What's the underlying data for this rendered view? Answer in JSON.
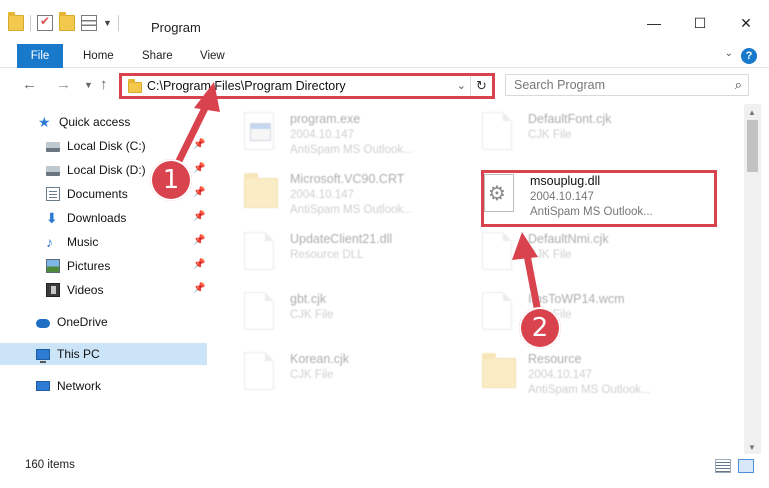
{
  "window": {
    "title": "Program",
    "minimize": "—",
    "maximize": "☐",
    "close": "✕"
  },
  "ribbon": {
    "tabs": [
      "File",
      "Home",
      "Share",
      "View"
    ],
    "help": "?"
  },
  "address": {
    "path": "C:\\Program Files\\Program Directory",
    "search_placeholder": "Search Program"
  },
  "sidebar": {
    "items": [
      {
        "label": "Quick access",
        "icon": "star-icon"
      },
      {
        "label": "Local Disk (C:)",
        "icon": "drive-icon",
        "pinned": true
      },
      {
        "label": "Local Disk (D:)",
        "icon": "drive-icon",
        "pinned": true
      },
      {
        "label": "Documents",
        "icon": "documents-icon",
        "pinned": true
      },
      {
        "label": "Downloads",
        "icon": "downloads-icon",
        "pinned": true
      },
      {
        "label": "Music",
        "icon": "music-icon",
        "pinned": true
      },
      {
        "label": "Pictures",
        "icon": "pictures-icon",
        "pinned": true
      },
      {
        "label": "Videos",
        "icon": "videos-icon",
        "pinned": true
      },
      {
        "label": "OneDrive",
        "icon": "onedrive-icon"
      },
      {
        "label": "This PC",
        "icon": "this-pc-icon",
        "selected": true
      },
      {
        "label": "Network",
        "icon": "network-icon"
      }
    ]
  },
  "files": [
    {
      "name": "program.exe",
      "line1": "2004.10.147",
      "line2": "AntiSpam MS Outlook...",
      "type": "exe"
    },
    {
      "name": "DefaultFont.cjk",
      "line1": "CJK File",
      "line2": "",
      "type": "doc"
    },
    {
      "name": "Microsoft.VC90.CRT",
      "line1": "2004.10.147",
      "line2": "AntiSpam MS Outlook...",
      "type": "folder"
    },
    {
      "name": "msouplug.dll",
      "line1": "2004.10.147",
      "line2": "AntiSpam MS Outlook...",
      "type": "dll"
    },
    {
      "name": "UpdateClient21.dll",
      "line1": "Resource DLL",
      "line2": "",
      "type": "doc"
    },
    {
      "name": "DefaultNmi.cjk",
      "line1": "CJK File",
      "line2": "",
      "type": "doc"
    },
    {
      "name": "gbt.cjk",
      "line1": "CJK File",
      "line2": "",
      "type": "doc"
    },
    {
      "name": "ImsToWP14.wcm",
      "line1": "CJK File",
      "line2": "",
      "type": "doc"
    },
    {
      "name": "Korean.cjk",
      "line1": "CJK File",
      "line2": "",
      "type": "doc"
    },
    {
      "name": "Resource",
      "line1": "2004.10.147",
      "line2": "AntiSpam MS Outlook...",
      "type": "folder"
    }
  ],
  "status": {
    "item_count": "160 items"
  },
  "callouts": [
    "1",
    "2"
  ],
  "colors": {
    "accent": "#1979ca",
    "highlight": "#d9434d",
    "selected": "#cce4f7"
  }
}
